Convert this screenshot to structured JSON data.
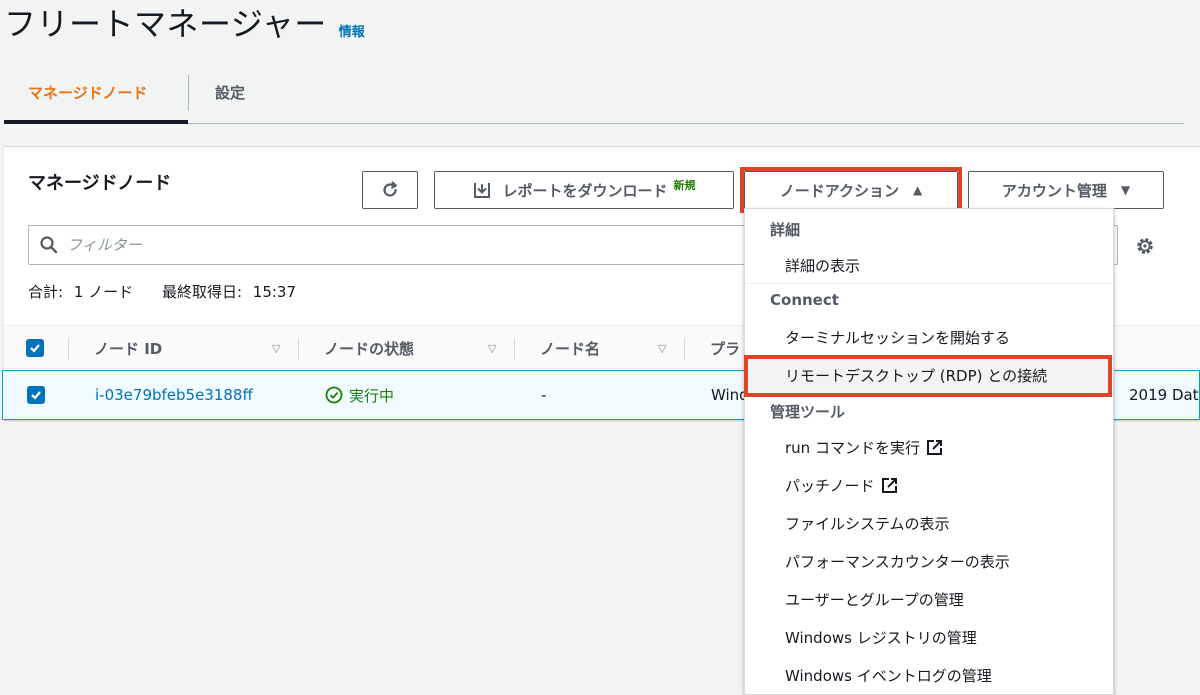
{
  "header": {
    "title": "フリートマネージャー",
    "info_link": "情報"
  },
  "tabs": [
    {
      "label": "マネージドノード",
      "active": true
    },
    {
      "label": "設定",
      "active": false
    }
  ],
  "panel": {
    "title": "マネージドノード",
    "buttons": {
      "report": "レポートをダウンロード",
      "report_badge": "新規",
      "node_actions": "ノードアクション",
      "account": "アカウント管理"
    },
    "filter_placeholder": "フィルター",
    "summary": {
      "total_label": "合計:",
      "total_value": "1 ノード",
      "last_fetched_label": "最終取得日:",
      "last_fetched_value": "15:37"
    }
  },
  "table": {
    "columns": [
      "ノード ID",
      "ノードの状態",
      "ノード名",
      "プラ"
    ],
    "rows": [
      {
        "node_id": "i-03e79bfeb5e3188ff",
        "status": "実行中",
        "name": "-",
        "platform": "Windo",
        "platform_detail": "2019 Dat",
        "selected": true
      }
    ]
  },
  "menu": {
    "groups": [
      {
        "label": "詳細",
        "items": [
          "詳細の表示"
        ]
      },
      {
        "label": "Connect",
        "items": [
          "ターミナルセッションを開始する",
          "リモートデスクトップ (RDP) との接続"
        ]
      },
      {
        "label": "管理ツール",
        "items": [
          "run コマンドを実行",
          "パッチノード",
          "ファイルシステムの表示",
          "パフォーマンスカウンターの表示",
          "ユーザーとグループの管理",
          "Windows レジストリの管理",
          "Windows イベントログの管理"
        ]
      }
    ]
  },
  "colors": {
    "accent_orange": "#ec7211",
    "link_blue": "#0073bb",
    "success_green": "#1d8102",
    "highlight_red": "#e2412a"
  }
}
